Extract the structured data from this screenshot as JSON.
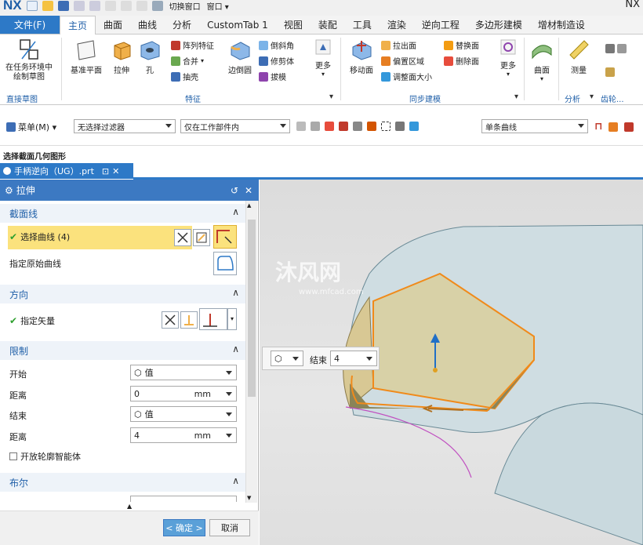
{
  "titlebar": {
    "logo": "NX",
    "switch_window": "切换窗口",
    "window_menu": "窗口 ▾",
    "right_title": "NX"
  },
  "menu": {
    "file": "文件(F)",
    "tabs": [
      "主页",
      "曲面",
      "曲线",
      "分析",
      "CustomTab 1",
      "视图",
      "装配",
      "工具",
      "渲染",
      "逆向工程",
      "多边形建模",
      "增材制造设"
    ],
    "active_index": 0
  },
  "ribbon": {
    "sketch_btn": "在任务环境中绘制草图",
    "sketch_group": "直接草图",
    "datum_plane": "基准平面",
    "extrude": "拉伸",
    "hole": "孔",
    "pattern_feature": "阵列特征",
    "unite": "合并",
    "shell": "抽壳",
    "edge_blend": "边倒圆",
    "chamfer": "倒斜角",
    "trim_body": "修剪体",
    "draft": "拔模",
    "more1": "更多",
    "feature_group": "特征",
    "move_face": "移动面",
    "pull_face": "拉出面",
    "offset_region": "偏置区域",
    "resize_face": "调整面大小",
    "replace_face": "替换面",
    "delete_face": "删除面",
    "more2": "更多",
    "sync_group": "同步建模",
    "surface": "曲面",
    "measure": "测量",
    "analysis_group": "分析",
    "gear_group": "齿轮..."
  },
  "toolbar": {
    "menu_btn": "菜单(M) ▾",
    "filter": "无选择过滤器",
    "scope": "仅在工作部件内",
    "curve_rule": "单条曲线"
  },
  "prompt": "选择截面几何图形",
  "file_tab": "手柄逆向（UG）.prt",
  "dialog": {
    "title": "拉伸",
    "section": {
      "title": "截面线",
      "select_curve": "选择曲线 (4)",
      "specify_origin": "指定原始曲线"
    },
    "direction": {
      "title": "方向",
      "specify_vector": "指定矢量"
    },
    "limits": {
      "title": "限制",
      "start_label": "开始",
      "start_value": "值",
      "distance_label": "距离",
      "start_distance": "0",
      "unit": "mm",
      "end_label": "结束",
      "end_value": "值",
      "end_distance": "4",
      "open_profile": "开放轮廓智能体"
    },
    "boolean": {
      "title": "布尔"
    },
    "ok": "< 确定 >",
    "cancel": "取消"
  },
  "viewport": {
    "onscreen_label": "结束",
    "onscreen_value": "4",
    "watermark": "沐风网",
    "watermark_url": "www.mfcad.com"
  }
}
